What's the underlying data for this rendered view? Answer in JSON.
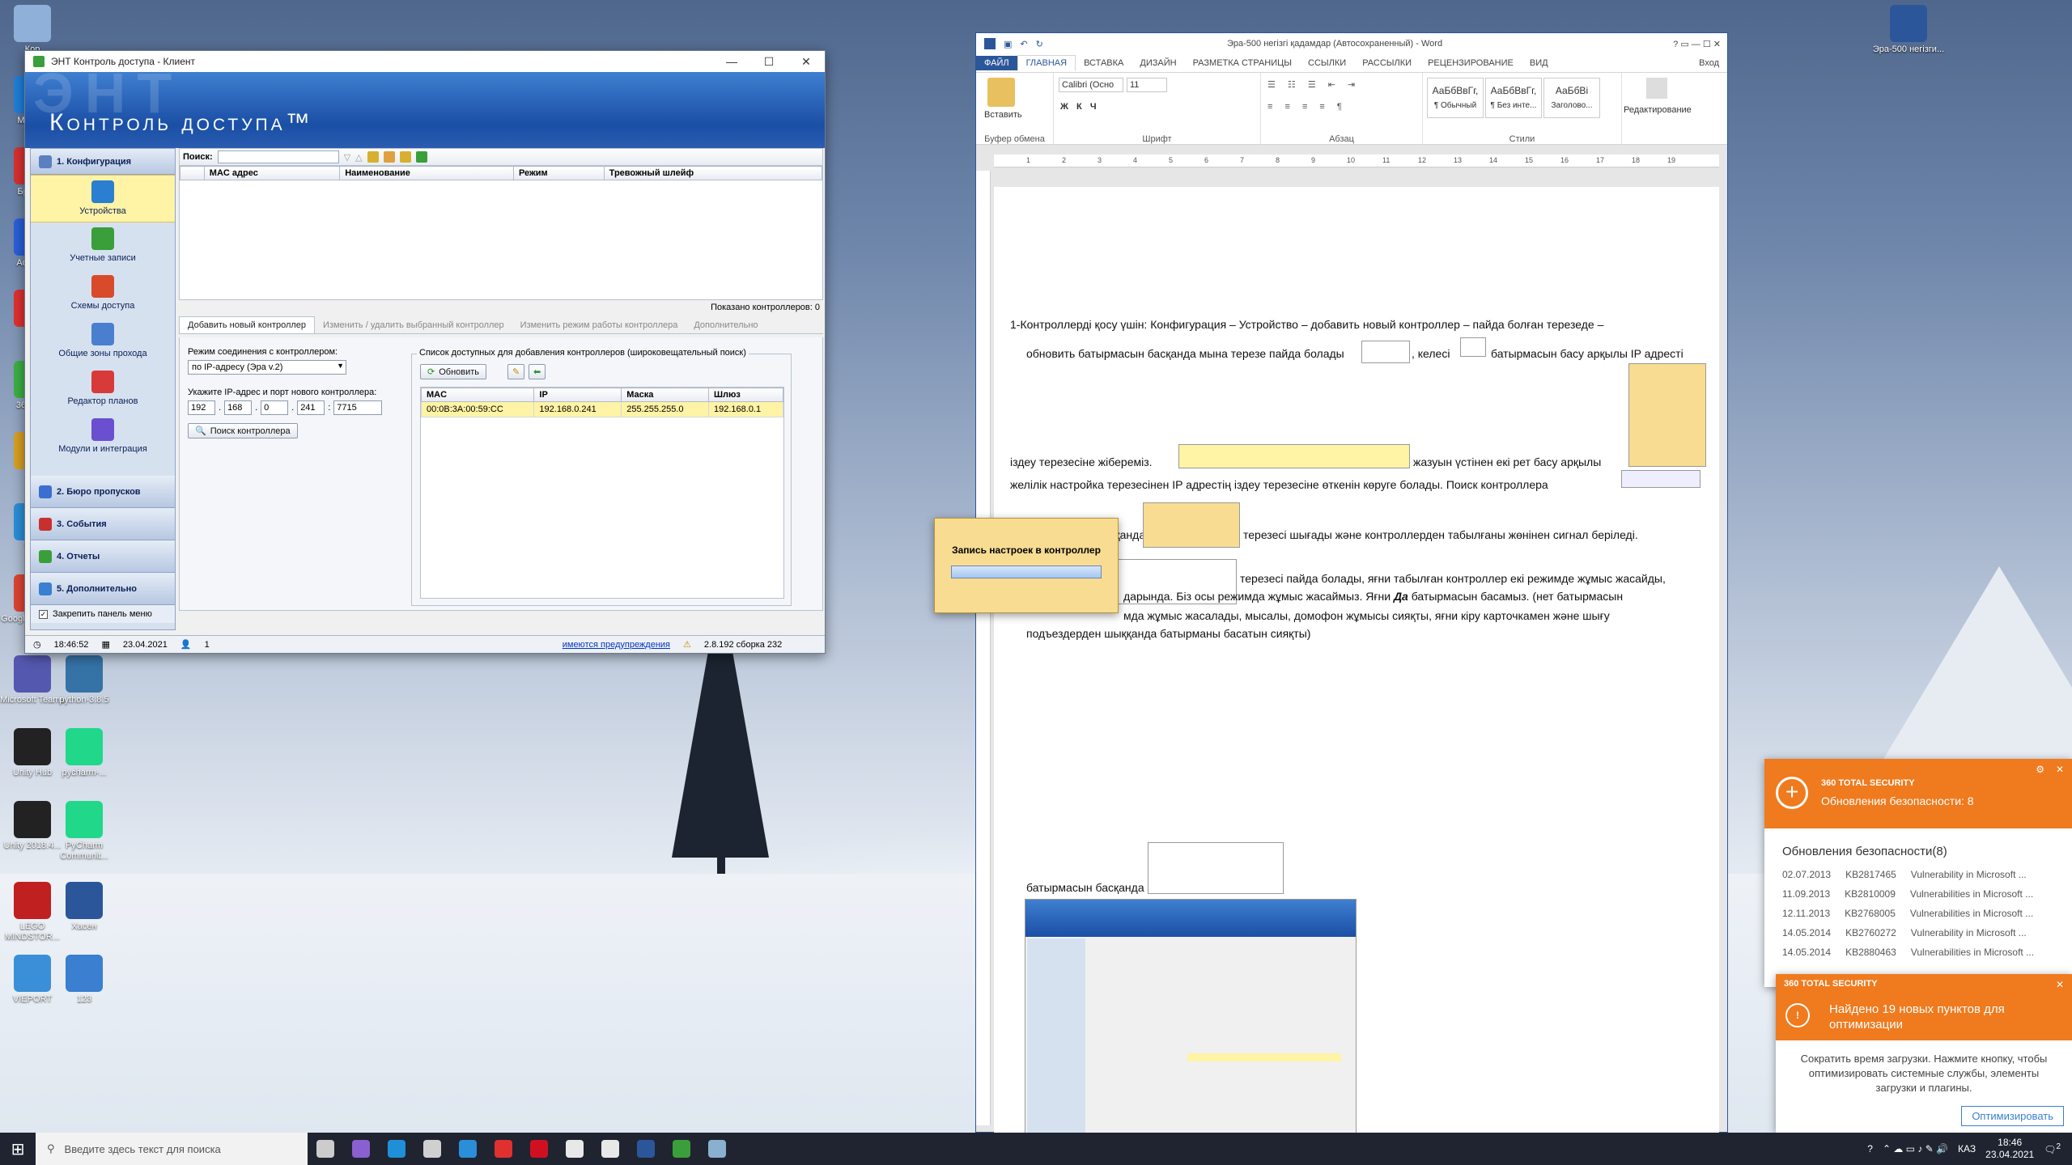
{
  "desktop": {
    "icons": [
      {
        "label": "Кор",
        "color": "#8fb0d8"
      },
      {
        "label": "Micr Ed",
        "color": "#1f7fd8"
      },
      {
        "label": "Бра Оп",
        "color": "#d83030"
      },
      {
        "label": "Ad Phot",
        "color": "#2a5fd8"
      },
      {
        "label": "Yan",
        "color": "#e03030"
      },
      {
        "label": "360 Sec",
        "color": "#3cb043"
      },
      {
        "label": "Lib",
        "color": "#d8a020"
      },
      {
        "label": "Tele",
        "color": "#2a8fd8"
      },
      {
        "label": "Google Chrome",
        "color": "#dd4433"
      },
      {
        "label": "Microsoft Teams",
        "color": "#5558af"
      },
      {
        "label": "Unity Hub",
        "color": "#222222"
      },
      {
        "label": "Unity 2018.4...",
        "color": "#222222"
      },
      {
        "label": "LEGO MINDSTOR...",
        "color": "#c02020"
      },
      {
        "label": "VIEPORT",
        "color": "#3a8fd8"
      },
      {
        "label": "123",
        "color": "#3a7fd0"
      },
      {
        "label": "python-3.8.5",
        "color": "#3572a5"
      },
      {
        "label": "pycharm-...",
        "color": "#21d789"
      },
      {
        "label": "PyCharm Communit...",
        "color": "#21d789"
      },
      {
        "label": "Хасен",
        "color": "#2b579a"
      },
      {
        "label": "123",
        "color": "#3a7fd0"
      },
      {
        "label": "Эра-500 негізги...",
        "color": "#2b579a"
      }
    ]
  },
  "ent": {
    "window_title": "ЭНТ Контроль доступа - Клиент",
    "banner_title": "Контроль доступа™",
    "banner_ghost": "ЭНТ",
    "config_header": "1. Конфигурация",
    "nav": [
      {
        "label": "Устройства",
        "color": "#2a7fd0"
      },
      {
        "label": "Учетные записи",
        "color": "#3a9f3a"
      },
      {
        "label": "Схемы доступа",
        "color": "#d84a2a"
      },
      {
        "label": "Общие зоны прохода",
        "color": "#4a7fd0"
      },
      {
        "label": "Редактор планов",
        "color": "#d83a3a"
      },
      {
        "label": "Модули и интеграция",
        "color": "#6a4fd0"
      }
    ],
    "sections": [
      "2. Бюро пропусков",
      "3. События",
      "4. Отчеты",
      "5. Дополнительно"
    ],
    "pin_label": "Закрепить панель меню",
    "search_label": "Поиск:",
    "columns": [
      "MAC адрес",
      "Наименование",
      "Режим",
      "Тревожный шлейф"
    ],
    "shown": "Показано контроллеров: 0",
    "tabs": [
      "Добавить новый контроллер",
      "Изменить / удалить выбранный контроллер",
      "Изменить режим работы контроллера",
      "Дополнительно"
    ],
    "mode_label": "Режим соединения с контроллером:",
    "mode_value": "по IP-адресу (Эра v.2)",
    "ip_label": "Укажите IP-адрес и порт нового контроллера:",
    "ip": [
      "192",
      "168",
      "0",
      "241"
    ],
    "port": "7715",
    "find_button": "Поиск контроллера",
    "list_label": "Список доступных для добавления контроллеров (широковещательный поиск)",
    "refresh_button": "Обновить",
    "found_columns": [
      "MAC",
      "IP",
      "Маска",
      "Шлюз"
    ],
    "found_row": [
      "00:0B:3A:00:59:CC",
      "192.168.0.241",
      "255.255.255.0",
      "192.168.0.1"
    ],
    "status_time": "18:46:52",
    "status_date": "23.04.2021",
    "status_users": "1",
    "status_warn": "имеются предупреждения",
    "status_build": "2.8.192 сборка 232"
  },
  "popup": {
    "title": "Запись настроек в контроллер"
  },
  "word": {
    "title": "Эра-500 негізгі қадамдар (Автосохраненный) - Word",
    "tabs": [
      "ФАЙЛ",
      "ГЛАВНАЯ",
      "ВСТАВКА",
      "ДИЗАЙН",
      "РАЗМЕТКА СТРАНИЦЫ",
      "ССЫЛКИ",
      "РАССЫЛКИ",
      "РЕЦЕНЗИРОВАНИЕ",
      "ВИД"
    ],
    "login": "Вход",
    "font_name": "Calibri (Осно",
    "font_size": "11",
    "groups": [
      "Буфер обмена",
      "Шрифт",
      "Абзац",
      "Стили",
      "Редактирование"
    ],
    "paste": "Вставить",
    "styles": [
      {
        "sample": "АаБбВвГг,",
        "name": "¶ Обычный"
      },
      {
        "sample": "АаБбВвГг,",
        "name": "¶ Без инте..."
      },
      {
        "sample": "АаБбВі",
        "name": "Заголово..."
      }
    ],
    "edit_label": "Редактирование",
    "lines": [
      "1-Контроллерді қосу үшін: Конфигурация – Устройство – добавить новый контроллер – пайда болған терезеде –",
      "обновить батырмасын басқанда мына терезе пайда болады",
      ", келесі",
      "батырмасын басу арқылы IP адресті",
      "іздеу терезесіне жібереміз.",
      "жазуын үстінен екі рет басу арқылы",
      "желілік настройка терезесінен IP адрестің іздеу терезесіне өткенін көруге болады. Поиск  контроллера",
      "Батырмасын басқанда",
      "терезесі шығады және контроллерден табылғаны жөнінен сигнал беріледі.",
      "терезесі пайда болады, яғни табылған контроллер екі режимде жұмыс жасайды,",
      "дарында. Біз осы режимда жұмыс жасаймыз. Яғни",
      "Да",
      "батырмасын басамыз. (нет батырмасын",
      "мда жұмыс жасалады, мысалы, домофон жұмысы сияқты, яғни кіру карточкамен және шығу",
      "подъездерден шыққанда батырманы басатын сияқты)",
      "батырмасын басқанда"
    ],
    "ruler_numbers": [
      "1",
      "2",
      "3",
      "4",
      "5",
      "6",
      "7",
      "8",
      "9",
      "10",
      "11",
      "12",
      "13",
      "14",
      "15",
      "16",
      "17",
      "18",
      "19"
    ]
  },
  "n360": [
    {
      "brand": "360 TOTAL SECURITY",
      "headline": "Обновления безопасности: 8",
      "list_title": "Обновления безопасности(8)",
      "rows": [
        [
          "02.07.2013",
          "KB2817465",
          "Vulnerability in Microsoft ..."
        ],
        [
          "11.09.2013",
          "KB2810009",
          "Vulnerabilities in Microsoft ..."
        ],
        [
          "12.11.2013",
          "KB2768005",
          "Vulnerabilities in Microsoft ..."
        ],
        [
          "14.05.2014",
          "KB2760272",
          "Vulnerability in Microsoft ..."
        ],
        [
          "14.05.2014",
          "KB2880463",
          "Vulnerabilities in Microsoft ..."
        ]
      ]
    },
    {
      "brand": "360 TOTAL SECURITY",
      "headline": "Найдено 19 новых пунктов для оптимизации",
      "body": "Сократить время загрузки. Нажмите кнопку, чтобы оптимизировать системные службы, элементы загрузки и плагины.",
      "button": "Оптимизировать"
    }
  ],
  "taskbar": {
    "search_placeholder": "Введите здесь текст для поиска",
    "apps": [
      {
        "name": "task-view",
        "color": "#cccccc"
      },
      {
        "name": "cortana",
        "color": "#8a5fd0"
      },
      {
        "name": "edge",
        "color": "#1f8fd8"
      },
      {
        "name": "store",
        "color": "#d0d0d0"
      },
      {
        "name": "mail",
        "color": "#2a8fd8"
      },
      {
        "name": "yandex",
        "color": "#e03030"
      },
      {
        "name": "opera",
        "color": "#d01020"
      },
      {
        "name": "files",
        "color": "#e8e8e8"
      },
      {
        "name": "yandex-browser",
        "color": "#e8e8e8"
      },
      {
        "name": "word",
        "color": "#2b579a"
      },
      {
        "name": "ent",
        "color": "#3a9f3a"
      },
      {
        "name": "tool",
        "color": "#8ab0d0"
      }
    ],
    "lang": "КАЗ",
    "time": "18:46",
    "date": "23.04.2021",
    "notif_count": "2"
  }
}
